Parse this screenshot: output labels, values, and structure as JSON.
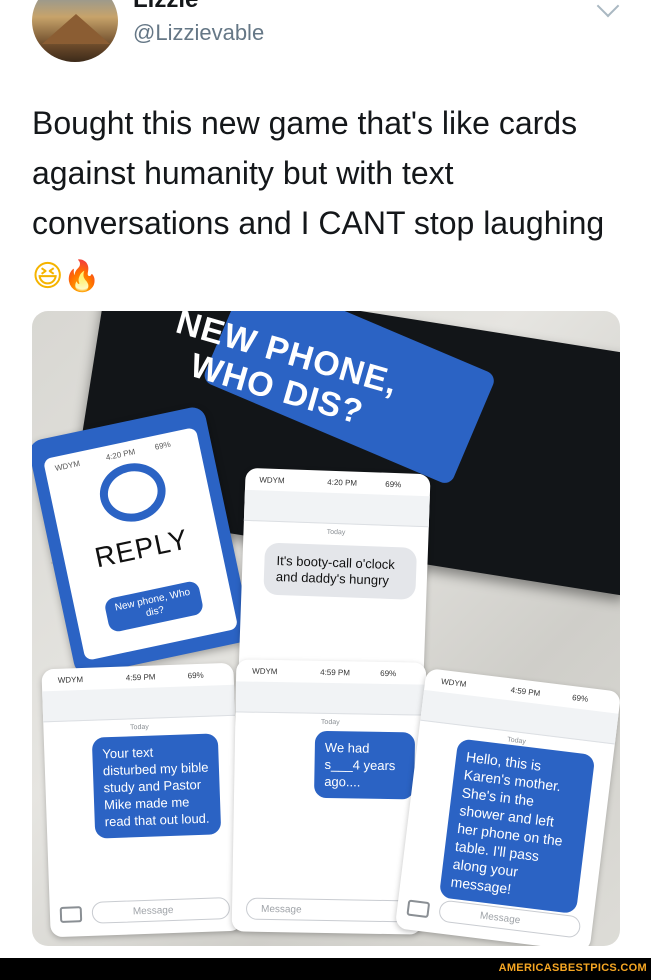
{
  "tweet": {
    "display_name": "Lizzie",
    "handle": "@Lizzievable",
    "text": "Bought this new game that's like cards against humanity but with text conversations and I CANT stop laughing",
    "emoji_laugh": "😆",
    "emoji_fire": "🔥"
  },
  "photo": {
    "box_title": "NEW PHONE, WHO DIS?",
    "reply_card": {
      "word": "REPLY",
      "tag": "New phone, Who dis?",
      "carrier": "WDYM",
      "time": "4:20 PM",
      "battery": "69%"
    },
    "cards": [
      {
        "carrier": "WDYM",
        "time": "4:20 PM",
        "battery": "69%",
        "day": "Today",
        "message": "It's booty-call o'clock and daddy's hungry"
      },
      {
        "carrier": "WDYM",
        "time": "4:59 PM",
        "battery": "69%",
        "day": "Today",
        "message": "Your text disturbed my bible study and Pastor Mike made me read that out loud.",
        "input_placeholder": "Message"
      },
      {
        "carrier": "WDYM",
        "time": "4:59 PM",
        "battery": "69%",
        "day": "Today",
        "message": "We had s___4 years ago....",
        "input_placeholder": "Message"
      },
      {
        "carrier": "WDYM",
        "time": "4:59 PM",
        "battery": "69%",
        "day": "Today",
        "message": "Hello, this is Karen's mother. She's in the shower and left her phone on the table. I'll pass along your message!",
        "input_placeholder": "Message"
      }
    ]
  },
  "watermark": "AMERICASBESTPICS.COM"
}
